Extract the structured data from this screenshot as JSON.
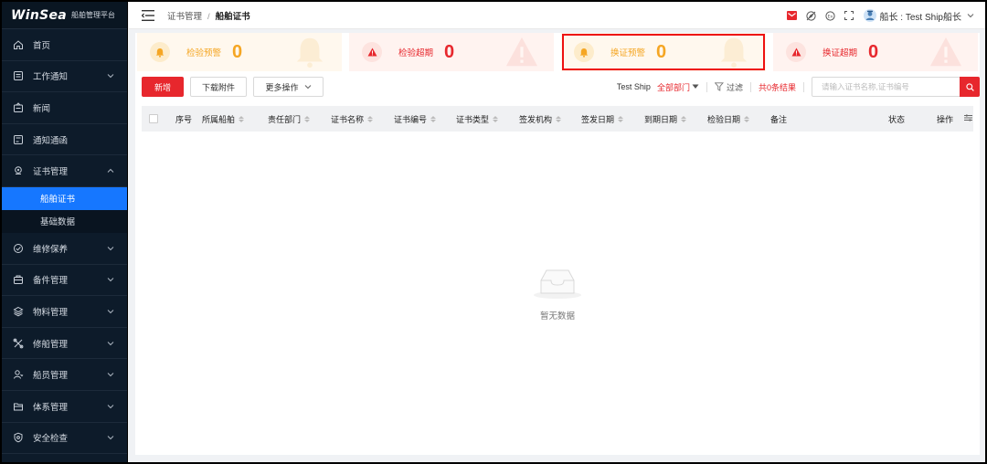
{
  "sidebar": {
    "logo_main": "WinSea",
    "logo_sub": "船舶管理平台",
    "items": [
      {
        "label": "首页",
        "icon": "home-icon",
        "has_children": false
      },
      {
        "label": "工作通知",
        "icon": "notice-icon",
        "has_children": true
      },
      {
        "label": "新闻",
        "icon": "news-icon",
        "has_children": false
      },
      {
        "label": "通知通函",
        "icon": "circular-icon",
        "has_children": false
      },
      {
        "label": "证书管理",
        "icon": "certificate-icon",
        "has_children": true,
        "expanded": true
      },
      {
        "label": "维修保养",
        "icon": "maintenance-icon",
        "has_children": true
      },
      {
        "label": "备件管理",
        "icon": "spare-parts-icon",
        "has_children": true
      },
      {
        "label": "物料管理",
        "icon": "material-icon",
        "has_children": true
      },
      {
        "label": "修船管理",
        "icon": "repair-icon",
        "has_children": true
      },
      {
        "label": "船员管理",
        "icon": "crew-icon",
        "has_children": true
      },
      {
        "label": "体系管理",
        "icon": "system-icon",
        "has_children": true
      },
      {
        "label": "安全检查",
        "icon": "safety-icon",
        "has_children": true
      }
    ],
    "submenu": [
      {
        "label": "船舶证书",
        "active": true
      },
      {
        "label": "基础数据",
        "active": false
      }
    ]
  },
  "header": {
    "breadcrumb_parent": "证书管理",
    "breadcrumb_sep": "/",
    "breadcrumb_current": "船舶证书",
    "user_label": "船长 : Test Ship船长",
    "icons": [
      "mail-icon",
      "compass-icon",
      "language-icon",
      "fullscreen-icon"
    ]
  },
  "cards": [
    {
      "label": "检验预警",
      "value": "0",
      "kind": "bell",
      "color": "#f5a623"
    },
    {
      "label": "检验超期",
      "value": "0",
      "kind": "alert",
      "color": "#e7272d"
    },
    {
      "label": "换证预警",
      "value": "0",
      "kind": "bell",
      "color": "#f5a623",
      "highlighted": true
    },
    {
      "label": "换证超期",
      "value": "0",
      "kind": "alert",
      "color": "#e7272d"
    }
  ],
  "toolbar": {
    "add_label": "新增",
    "download_label": "下载附件",
    "more_label": "更多操作",
    "ship_label": "Test Ship",
    "dept_label": "全部部门",
    "filter_label": "过滤",
    "result_label": "共0条结果",
    "search_placeholder": "请输入证书名称,证书编号"
  },
  "table": {
    "columns": [
      "序号",
      "所属船舶",
      "责任部门",
      "证书名称",
      "证书编号",
      "证书类型",
      "签发机构",
      "签发日期",
      "到期日期",
      "检验日期",
      "备注",
      "状态",
      "操作"
    ],
    "rows": [],
    "empty_text": "暂无数据"
  },
  "colors": {
    "brand_red": "#e7272d",
    "sidebar_bg": "#0d1b2a",
    "active_blue": "#1677ff",
    "warn_orange": "#f5a623"
  }
}
